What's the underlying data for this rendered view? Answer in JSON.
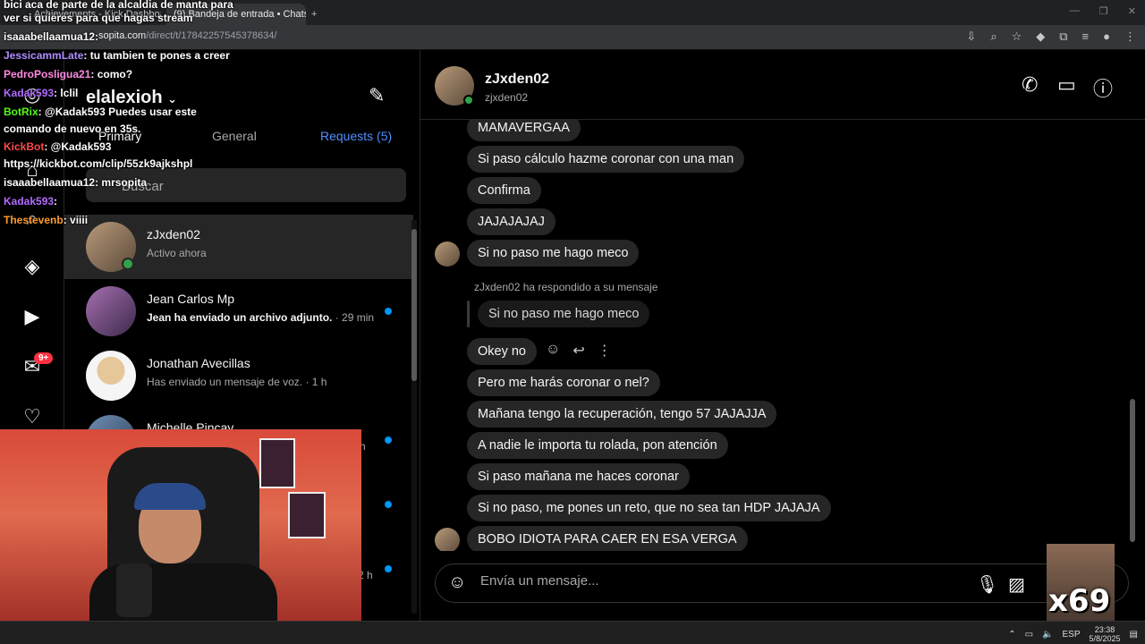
{
  "browser": {
    "tabs": [
      {
        "label": "Achievements - Kick Dashboard",
        "active": false
      },
      {
        "label": "(9) Bandeja de entrada • Chats",
        "active": true
      }
    ],
    "url_host": "sopita",
    "url_domain": ".com",
    "url_path": "/direct/t/17842257545378634/"
  },
  "rail": {
    "badge": "9+"
  },
  "inbox": {
    "username": "elalexioh",
    "tabs": [
      "Primary",
      "General",
      "Requests (5)"
    ],
    "search_placeholder": "Buscar",
    "threads": [
      {
        "name": "zJxden02",
        "sub": "Activo ahora",
        "time": ""
      },
      {
        "name": "Jean Carlos Mp",
        "sub": "Jean ha enviado un archivo adjunto.",
        "time": " · 29 min"
      },
      {
        "name": "Jonathan Avecillas",
        "sub": "Has enviado un mensaje de voz.",
        "time": " · 1 h"
      },
      {
        "name": "Michelle Pincay",
        "sub": "",
        "time": ""
      }
    ],
    "partial_times": [
      "h",
      "2 h"
    ]
  },
  "chat": {
    "name": "zJxden02",
    "handle": "zjxden02",
    "messages": [
      "MAMAVERGAA",
      "Si paso cálculo hazme coronar con una man",
      "Confirma",
      "JAJAJAJAJ",
      "Si no paso me hago meco"
    ],
    "reply_note": "zJxden02 ha respondido a su mensaje",
    "quoted": "Si no paso me hago meco",
    "messages_after": [
      "Okey no",
      "Pero me harás coronar o nel?",
      "Mañana tengo la recuperación, tengo 57 JAJAJJA",
      "A nadie le importa tu rolada, pon atención",
      "Si paso mañana me haces coronar",
      "Si no paso, me pones un reto, que no sea tan HDP JAJAJA",
      "BOBO IDIOTA PARA CAER EN ESA VERGA"
    ],
    "composer_placeholder": "Envía un mensaje..."
  },
  "stream_chat": [
    {
      "user": "",
      "text": "bici aca de parte de la alcaldia de manta para",
      "color": "#ffffff"
    },
    {
      "user": "",
      "text": "ver si quieres para que hagas stream",
      "color": "#ffffff"
    },
    {
      "user": "isaaabellaamua12",
      "text": ": ",
      "color": "#ffffff"
    },
    {
      "user": "JessicammLate",
      "text": ": tu tambien te pones a creer",
      "color": "#b18cff"
    },
    {
      "user": "PedroPosligua21",
      "text": ": como?",
      "color": "#ff8ae0"
    },
    {
      "user": "Kadak593",
      "text": ": lclil",
      "color": "#b06cff"
    },
    {
      "user": "BotRix",
      "text": ": @Kadak593 Puedes usar este",
      "color": "#53fc18"
    },
    {
      "user": "",
      "text": "comando de nuevo en 35s.",
      "color": "#ffffff"
    },
    {
      "user": "KickBot",
      "text": ": @Kadak593",
      "color": "#ff4a4a"
    },
    {
      "user": "",
      "text": "https://kickbot.com/clip/55zk9ajkshpl",
      "color": "#ffffff"
    },
    {
      "user": "isaaabellaamua12",
      "text": ": mrsopita",
      "color": "#ffffff"
    },
    {
      "user": "Kadak593",
      "text": ":",
      "color": "#b06cff"
    },
    {
      "user": "Thestevenb",
      "text": ": viiii",
      "color": "#ff9a2e"
    }
  ],
  "overlay": {
    "emote_text": "x69"
  },
  "taskbar": {
    "lang": "ESP",
    "time": "23:38",
    "date": "5/8/2025"
  }
}
